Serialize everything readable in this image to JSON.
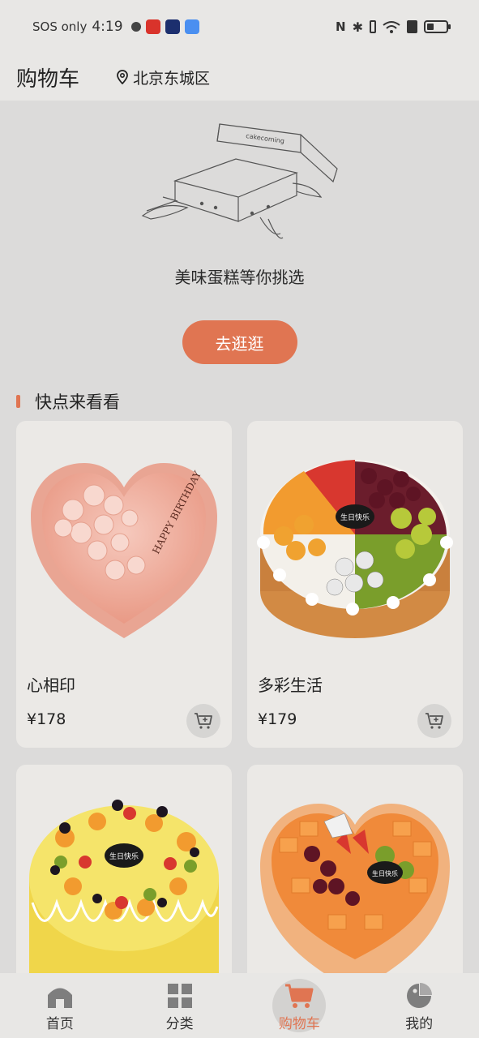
{
  "status_bar": {
    "carrier": "SOS only",
    "time": "4:19"
  },
  "header": {
    "title": "购物车",
    "location": "北京东城区"
  },
  "empty_state": {
    "box_brand": "cakecoming",
    "message": "美味蛋糕等你挑选",
    "button_label": "去逛逛"
  },
  "recommend": {
    "section_title": "快点来看看",
    "products": [
      {
        "name": "心相印",
        "price": "¥178",
        "plaque": "HAPPY BIRTHDAY"
      },
      {
        "name": "多彩生活",
        "price": "¥179",
        "plaque": "生日快乐"
      },
      {
        "name": "",
        "price": "",
        "plaque": "生日快乐"
      },
      {
        "name": "",
        "price": "",
        "plaque": "生日快乐"
      }
    ]
  },
  "tabbar": {
    "tabs": [
      {
        "label": "首页",
        "icon": "home-icon"
      },
      {
        "label": "分类",
        "icon": "grid-icon"
      },
      {
        "label": "购物车",
        "icon": "cart-icon",
        "active": true
      },
      {
        "label": "我的",
        "icon": "profile-icon"
      }
    ]
  },
  "colors": {
    "accent": "#e07552",
    "background": "#dcdbda",
    "card": "#ebe9e6"
  }
}
